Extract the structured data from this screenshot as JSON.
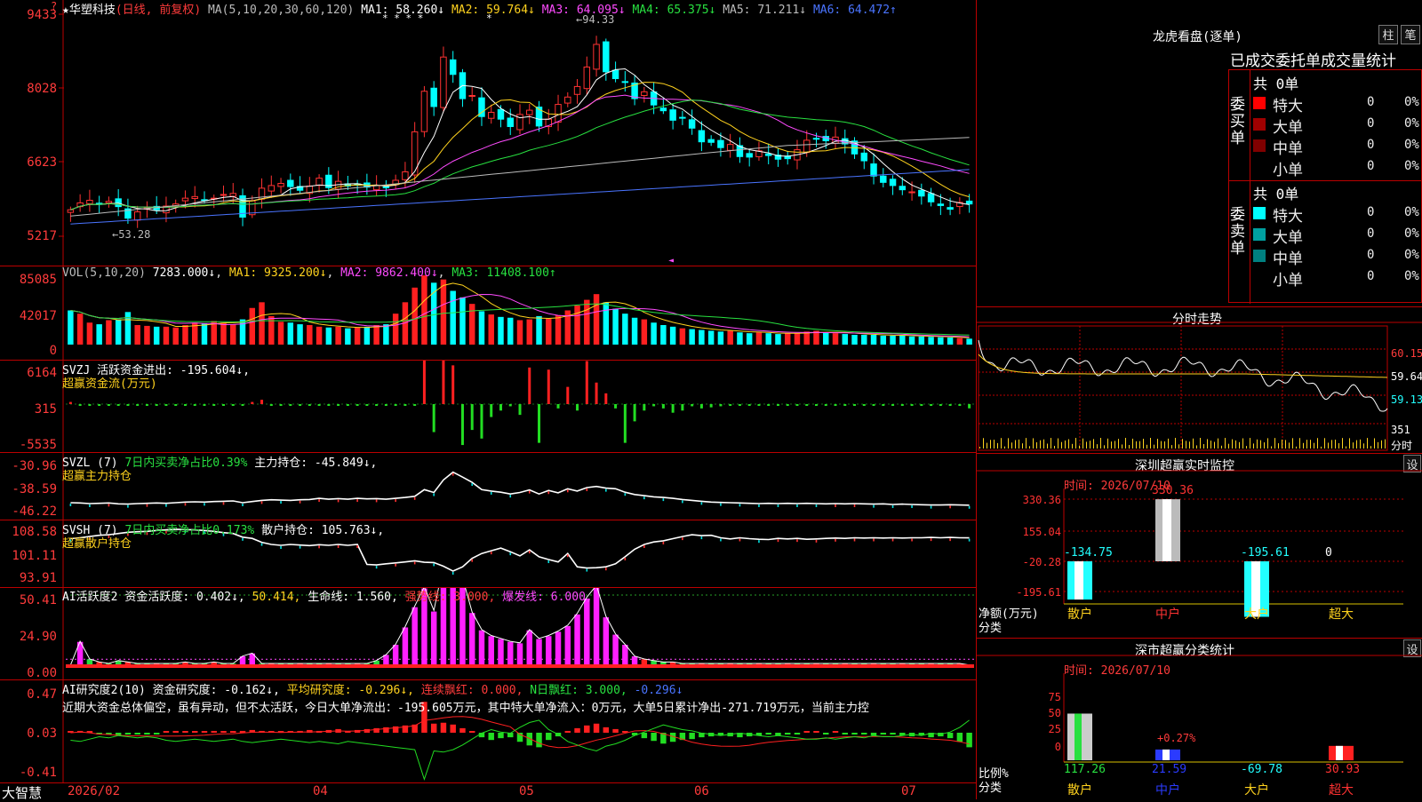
{
  "header": {
    "star": "★",
    "stock_name": "华塑科技",
    "mode": "(日线, 前复权)",
    "ma_label": "MA(5,10,20,30,60,120)",
    "ma1": "MA1: 58.260↓",
    "ma2": "MA2: 59.764↓",
    "ma3": "MA3: 64.095↓",
    "ma4": "MA4: 65.375↓",
    "ma5": "MA5: 71.211↓",
    "ma6": "MA6: 64.472↑",
    "question_mark": "?",
    "peak_label": "94.33",
    "low_label": "53.28",
    "dot_marks": "* * * *",
    "dot_mark_single": "*"
  },
  "price_axis": [
    "9433",
    "8028",
    "6623",
    "5217"
  ],
  "vol": {
    "axis": [
      "85085",
      "42017",
      "0"
    ],
    "title": "VOL(5,10,20)",
    "vol_value": "7283.000↓",
    "ma1": "MA1: 9325.200↓",
    "ma2": "MA2: 9862.400↓",
    "ma3": "MA3: 11408.100↑"
  },
  "svzj": {
    "axis": [
      "6164",
      "315",
      "-5535"
    ],
    "line1": "SVZJ  活跃资金进出: -195.604↓,",
    "line2": "超赢资金流(万元)"
  },
  "svzl": {
    "axis": [
      "-30.96",
      "-38.59",
      "-46.22"
    ],
    "title": "SVZL  (7)",
    "ratio": "7日内买卖净占比0.39%",
    "hold": "主力持仓: -45.849↓,",
    "line2": "超赢主力持仓"
  },
  "svsh": {
    "axis": [
      "108.58",
      "101.11",
      "93.91"
    ],
    "title": "SVSH  (7)",
    "ratio": "7日内买卖净占比0.173%",
    "hold": "散户持仓: 105.763↓,",
    "line2": "超赢散户持仓"
  },
  "ai1": {
    "axis": [
      "50.41",
      "24.90",
      "0.00"
    ],
    "title": "AI活跃度2",
    "a": "资金活跃度: 0.402↓,",
    "b": "50.414,",
    "c": "生命线: 1.560,",
    "d": "强势线: 3.000,",
    "e": "爆发线: 6.000,"
  },
  "ai2": {
    "axis": [
      "0.47",
      "0.03",
      "-0.41"
    ],
    "title": "AI研究度2(10)",
    "a": "资金研究度: -0.162↓,",
    "b": "平均研究度: -0.296↓,",
    "c": "连续飘红: 0.000,",
    "d": "N日飘红: 3.000,",
    "e": "-0.296↓",
    "summary": "近期大资金总体偏空，虽有异动，但不太活跃，今日大单净流出：-195.605万元，其中特大单净流入：0万元，大单5日累计净出-271.719万元，当前主力控"
  },
  "time_axis": {
    "logo": "大智慧",
    "labels": [
      "2026/02",
      "04",
      "05",
      "06",
      "07"
    ]
  },
  "right": {
    "dragon_title": "龙虎看盘(逐单)",
    "btn_zhu": "柱",
    "btn_bi": "笔",
    "tabs_header": "已成交委托单成交量统计",
    "buy_side": "委买单",
    "sell_side": "委卖单",
    "buy_total": "共 0单",
    "sell_total": "共 0单",
    "buy_rows": [
      {
        "name": "特大",
        "count": "0",
        "pct": "0%",
        "color": "#ff0000"
      },
      {
        "name": "大单",
        "count": "0",
        "pct": "0%",
        "color": "#a00000"
      },
      {
        "name": "中单",
        "count": "0",
        "pct": "0%",
        "color": "#800000"
      },
      {
        "name": "小单",
        "count": "0",
        "pct": "0%",
        "color": "#000000"
      }
    ],
    "sell_rows": [
      {
        "name": "特大",
        "count": "0",
        "pct": "0%",
        "color": "#00ffff"
      },
      {
        "name": "大单",
        "count": "0",
        "pct": "0%",
        "color": "#00a0a0"
      },
      {
        "name": "中单",
        "count": "0",
        "pct": "0%",
        "color": "#008080"
      },
      {
        "name": "小单",
        "count": "0",
        "pct": "0%",
        "color": "#000000"
      }
    ],
    "intraday_title": "分时走势",
    "intraday_axis": [
      "60.15",
      "59.64",
      "59.13"
    ],
    "intraday_vol": "351",
    "intraday_vol_unit": "分时",
    "monitor_title": "深圳超赢实时监控",
    "monitor_set": "设",
    "monitor_time": "时间: 2026/07/10",
    "monitor_axis": [
      "330.36",
      "155.04",
      "-20.28",
      "-195.61"
    ],
    "monitor_unit1": "净额(万元)",
    "monitor_unit2": "分类",
    "monitor_cats": [
      "散户",
      "中户",
      "大户",
      "超大"
    ],
    "monitor_values": [
      "-134.75",
      "330.36",
      "-195.61",
      "0"
    ],
    "class_title": "深市超赢分类统计",
    "class_set": "设",
    "class_time": "时间: 2026/07/10",
    "class_axis": [
      "75",
      "50",
      "25",
      "0"
    ],
    "class_note": "+0.27%",
    "class_unit1": "比例%",
    "class_unit2": "分类",
    "class_cats": [
      "散户",
      "中户",
      "大户",
      "超大"
    ],
    "class_values": [
      "117.26",
      "21.59",
      "-69.78",
      "30.93"
    ]
  },
  "chart_data": {
    "type": "candlestick",
    "title": "华塑科技 (日线, 前复权)",
    "ylim": [
      52.17,
      94.33
    ],
    "ma_legend": [
      "MA1",
      "MA2",
      "MA3",
      "MA4",
      "MA5",
      "MA6"
    ],
    "ma_colors": [
      "#ffffff",
      "#ffd21e",
      "#ff4bff",
      "#28e040",
      "#bbbbbb",
      "#4a74ff"
    ],
    "close_series": [
      57.2,
      58.5,
      59.0,
      58.2,
      58.8,
      57.8,
      55.6,
      56.8,
      57.6,
      57.2,
      57.9,
      58.3,
      59.4,
      59.7,
      59.1,
      59.4,
      60.1,
      60.3,
      55.8,
      58.9,
      61.3,
      61.8,
      62.2,
      61.6,
      60.9,
      61.7,
      63.2,
      61.4,
      62.6,
      61.7,
      61.9,
      61.5,
      61.8,
      61.4,
      62.8,
      64.4,
      72.0,
      79.7,
      76.8,
      86.2,
      82.9,
      78.3,
      78.9,
      74.9,
      75.7,
      74.4,
      73.0,
      75.3,
      76.1,
      73.1,
      74.4,
      77.2,
      78.6,
      80.6,
      84.3,
      88.6,
      83.4,
      82.1,
      81.4,
      78.3,
      79.6,
      77.1,
      76.0,
      74.2,
      74.6,
      72.7,
      70.1,
      70.0,
      69.0,
      69.6,
      67.3,
      67.2,
      68.4,
      67.5,
      66.8,
      66.9,
      68.6,
      70.4,
      70.7,
      70.3,
      71.0,
      69.7,
      67.8,
      66.5,
      63.6,
      62.4,
      61.8,
      61.0,
      60.6,
      59.8,
      58.7,
      58.0,
      57.3,
      58.6,
      58.3
    ],
    "volume_series": [
      42000,
      38000,
      27000,
      25000,
      30000,
      31000,
      40000,
      24000,
      23000,
      22000,
      22000,
      21000,
      24000,
      27000,
      26000,
      29000,
      27000,
      25000,
      31000,
      45000,
      52000,
      35000,
      28000,
      27000,
      25000,
      24000,
      22000,
      21000,
      22000,
      20000,
      21000,
      22000,
      24000,
      25000,
      38000,
      52000,
      70000,
      85000,
      76000,
      80000,
      66000,
      58000,
      50000,
      41000,
      37000,
      34000,
      33000,
      30000,
      31000,
      35000,
      32000,
      36000,
      42000,
      48000,
      55000,
      62000,
      52000,
      44000,
      38000,
      33000,
      31000,
      27000,
      24000,
      22000,
      20000,
      19000,
      18000,
      17000,
      16000,
      17000,
      15000,
      14000,
      15000,
      14000,
      13000,
      14000,
      14000,
      16000,
      17000,
      15000,
      14000,
      13000,
      12000,
      12000,
      12000,
      11000,
      11000,
      11000,
      10000,
      10000,
      9500,
      9000,
      8700,
      8000,
      7283
    ],
    "svzj_flow": [
      100,
      -20,
      -40,
      -60,
      -30,
      -10,
      -80,
      -20,
      -10,
      -30,
      -50,
      -30,
      -10,
      -50,
      -20,
      -10,
      -40,
      -20,
      -50,
      100,
      200,
      -30,
      -30,
      -30,
      -20,
      -20,
      -10,
      -10,
      -10,
      -20,
      -20,
      -10,
      -10,
      -10,
      -10,
      -10,
      -60,
      2200,
      -1300,
      3200,
      1800,
      -1900,
      -1200,
      -1600,
      -600,
      -300,
      -100,
      -500,
      1700,
      -1800,
      1600,
      -200,
      800,
      -300,
      2000,
      1000,
      500,
      -200,
      -1800,
      -800,
      -300,
      -100,
      -200,
      -400,
      -300,
      -100,
      -200,
      -150,
      -100,
      -80,
      -60,
      -50,
      -40,
      -50,
      -40,
      -30,
      -40,
      -30,
      -40,
      -30,
      -20,
      -40,
      -30,
      -20,
      -20,
      -30,
      -20,
      -20,
      -30,
      -20,
      -30,
      -20,
      -30,
      -20,
      -196
    ],
    "svzl_hold": [
      -45.0,
      -45.1,
      -45.3,
      -45.2,
      -45.1,
      -45.4,
      -45.5,
      -45.3,
      -45.2,
      -45.1,
      -45.2,
      -45.0,
      -44.8,
      -44.7,
      -44.8,
      -44.6,
      -44.5,
      -44.4,
      -45.0,
      -44.6,
      -44.2,
      -44.0,
      -44.1,
      -44.2,
      -44.0,
      -43.9,
      -43.5,
      -43.8,
      -43.6,
      -43.8,
      -43.5,
      -43.7,
      -43.6,
      -43.8,
      -43.5,
      -43.2,
      -42.8,
      -40.5,
      -41.5,
      -37.2,
      -34.5,
      -36.2,
      -38.0,
      -40.5,
      -41.0,
      -41.4,
      -42.0,
      -41.5,
      -40.6,
      -42.0,
      -40.8,
      -41.6,
      -40.2,
      -41.0,
      -39.8,
      -39.4,
      -40.0,
      -40.2,
      -41.4,
      -42.2,
      -42.6,
      -43.0,
      -43.2,
      -43.5,
      -43.9,
      -44.2,
      -44.5,
      -44.8,
      -44.9,
      -45.0,
      -45.1,
      -45.2,
      -45.3,
      -45.2,
      -45.3,
      -45.2,
      -45.3,
      -45.2,
      -45.3,
      -45.4,
      -45.3,
      -45.4,
      -45.3,
      -45.4,
      -45.5,
      -45.4,
      -45.6,
      -45.5,
      -45.6,
      -45.7,
      -45.8,
      -45.8,
      -45.7,
      -45.8,
      -45.85
    ],
    "svsh_hold": [
      105.5,
      105.8,
      106.2,
      106.6,
      106.8,
      107.2,
      107.6,
      107.8,
      107.9,
      108.2,
      108.4,
      108.6,
      108.5,
      108.4,
      108.2,
      107.9,
      107.5,
      107.2,
      106.0,
      105.6,
      104.3,
      103.6,
      103.3,
      103.6,
      103.4,
      103.2,
      103.5,
      103.3,
      103.6,
      103.3,
      103.6,
      97.0,
      96.8,
      97.2,
      97.5,
      97.8,
      98.2,
      97.7,
      97.6,
      96.4,
      94.8,
      96.2,
      99.0,
      100.6,
      101.5,
      102.4,
      101.2,
      99.8,
      101.8,
      99.5,
      98.6,
      97.8,
      100.6,
      96.2,
      95.8,
      95.9,
      96.2,
      97.2,
      99.5,
      102.0,
      103.6,
      104.4,
      104.8,
      105.5,
      106.2,
      106.8,
      106.5,
      106.6,
      105.8,
      105.4,
      105.8,
      105.5,
      105.3,
      105.2,
      105.6,
      105.4,
      105.6,
      105.3,
      105.4,
      105.6,
      105.7,
      105.6,
      105.8,
      105.7,
      105.8,
      105.7,
      105.8,
      105.7,
      105.8,
      105.8,
      105.9,
      105.8,
      105.9,
      105.8,
      105.76
    ],
    "ai_active": [
      2,
      18,
      6,
      4,
      3,
      5,
      4,
      3,
      3,
      3,
      3,
      3,
      4,
      3,
      3,
      4,
      3,
      3,
      8,
      10,
      3,
      3,
      3,
      3,
      3,
      3,
      3,
      3,
      3,
      3,
      3,
      3,
      5,
      9,
      16,
      28,
      42,
      55,
      39,
      70,
      73,
      61,
      38,
      26,
      22,
      20,
      18,
      17,
      26,
      20,
      22,
      25,
      29,
      37,
      48,
      56,
      35,
      23,
      16,
      8,
      6,
      5,
      4,
      4,
      3,
      3,
      3,
      3,
      3,
      3,
      3,
      3,
      3,
      3,
      3,
      3,
      3,
      3,
      3,
      3,
      3,
      3,
      3,
      3,
      3,
      3,
      3,
      3,
      3,
      3,
      3,
      3,
      3,
      3,
      2
    ],
    "ai_research": [
      0.01,
      0.02,
      0.0,
      -0.02,
      -0.01,
      -0.03,
      -0.02,
      -0.01,
      -0.02,
      -0.01,
      0.01,
      0.02,
      0.01,
      0.0,
      0.01,
      0.02,
      0.01,
      0.0,
      0.02,
      0.03,
      0.02,
      0.01,
      0.0,
      0.01,
      0.02,
      0.03,
      0.02,
      0.03,
      0.04,
      0.02,
      0.03,
      0.04,
      0.05,
      0.06,
      0.07,
      0.08,
      0.09,
      0.34,
      0.1,
      0.11,
      0.09,
      0.05,
      0.0,
      -0.05,
      -0.08,
      -0.06,
      -0.05,
      -0.1,
      -0.14,
      -0.16,
      -0.08,
      -0.04,
      0.02,
      0.05,
      0.08,
      0.1,
      0.06,
      0.04,
      0.01,
      -0.03,
      -0.06,
      -0.09,
      -0.12,
      -0.1,
      -0.08,
      -0.07,
      -0.05,
      -0.04,
      -0.03,
      -0.04,
      -0.05,
      -0.04,
      -0.03,
      -0.02,
      -0.03,
      -0.02,
      -0.01,
      0.0,
      0.0,
      -0.01,
      0.0,
      -0.01,
      -0.02,
      -0.01,
      -0.03,
      -0.02,
      -0.02,
      -0.03,
      -0.04,
      -0.03,
      -0.05,
      -0.04,
      -0.06,
      -0.1,
      -0.16
    ]
  }
}
